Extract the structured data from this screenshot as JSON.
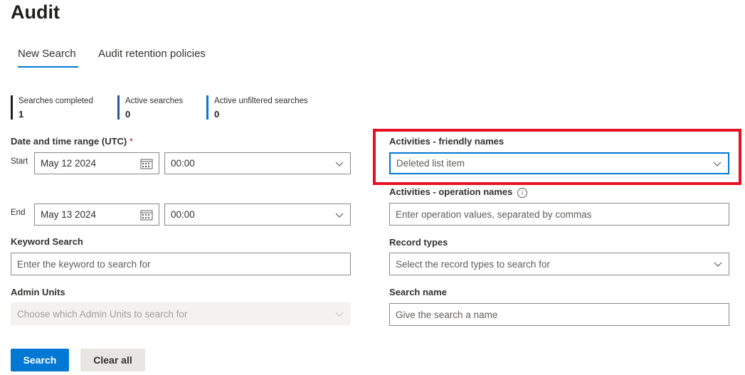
{
  "page": {
    "title": "Audit"
  },
  "tabs": [
    {
      "label": "New Search",
      "active": true
    },
    {
      "label": "Audit retention policies",
      "active": false
    }
  ],
  "stats": [
    {
      "label": "Searches completed",
      "value": "1",
      "color": "#201f1e"
    },
    {
      "label": "Active searches",
      "value": "0",
      "color": "#2b5797"
    },
    {
      "label": "Active unfiltered searches",
      "value": "0",
      "color": "#0078d4"
    }
  ],
  "date_range": {
    "label": "Date and time range (UTC)",
    "required_mark": "*",
    "start_label": "Start",
    "start_date": "May 12 2024",
    "start_time": "00:00",
    "end_label": "End",
    "end_date": "May 13 2024",
    "end_time": "00:00"
  },
  "keyword": {
    "label": "Keyword Search",
    "placeholder": "Enter the keyword to search for"
  },
  "admin_units": {
    "label": "Admin Units",
    "placeholder": "Choose which Admin Units to search for"
  },
  "activities_friendly": {
    "label": "Activities - friendly names",
    "value": "Deleted list item"
  },
  "activities_operation": {
    "label": "Activities - operation names",
    "placeholder": "Enter operation values, separated by commas"
  },
  "record_types": {
    "label": "Record types",
    "placeholder": "Select the record types to search for"
  },
  "search_name": {
    "label": "Search name",
    "placeholder": "Give the search a name"
  },
  "buttons": {
    "search": "Search",
    "clear_all": "Clear all"
  },
  "colors": {
    "accent": "#0078d4",
    "highlight": "#e81123"
  }
}
